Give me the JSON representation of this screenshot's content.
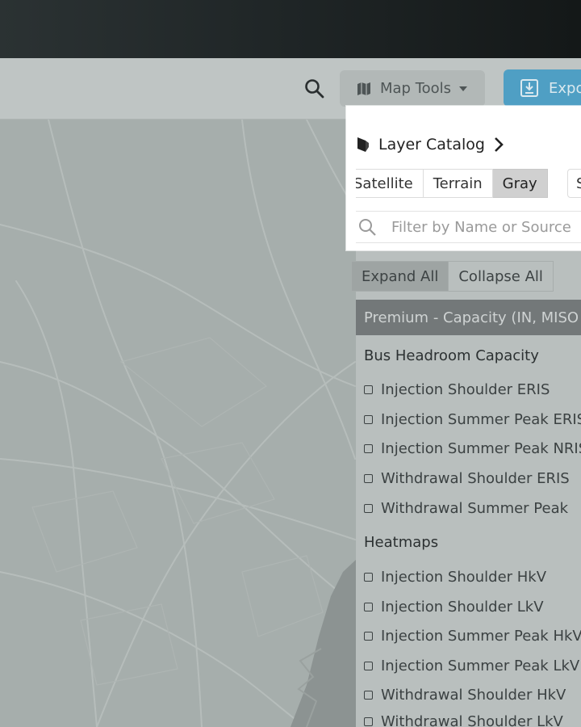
{
  "toolbar": {
    "map_tools_label": "Map Tools",
    "export_label": "Expo"
  },
  "catalog": {
    "title": "Layer Catalog",
    "basemaps": [
      "Satellite",
      "Terrain",
      "Gray"
    ],
    "active_basemap": "Gray",
    "extra_basemap_label": "S",
    "filter_placeholder": "Filter by Name or Source"
  },
  "controls": {
    "expand_all": "Expand All",
    "collapse_all": "Collapse All"
  },
  "section": {
    "title": "Premium - Capacity (IN, MISO"
  },
  "groups": [
    {
      "title": "Bus Headroom Capacity",
      "items": [
        "Injection Shoulder ERIS",
        "Injection Summer Peak ERIS",
        "Injection Summer Peak NRIS",
        "Withdrawal Shoulder ERIS",
        "Withdrawal Summer Peak"
      ]
    },
    {
      "title": "Heatmaps",
      "items": [
        "Injection Shoulder HkV",
        "Injection Shoulder LkV",
        "Injection Summer Peak HkV",
        "Injection Summer Peak LkV",
        "Withdrawal Shoulder HkV",
        "Withdrawal Shoulder LkV"
      ]
    }
  ],
  "colors": {
    "export_button": "#4f9fc4",
    "section_bar": "#737879",
    "map_land": "#a6aeac"
  }
}
